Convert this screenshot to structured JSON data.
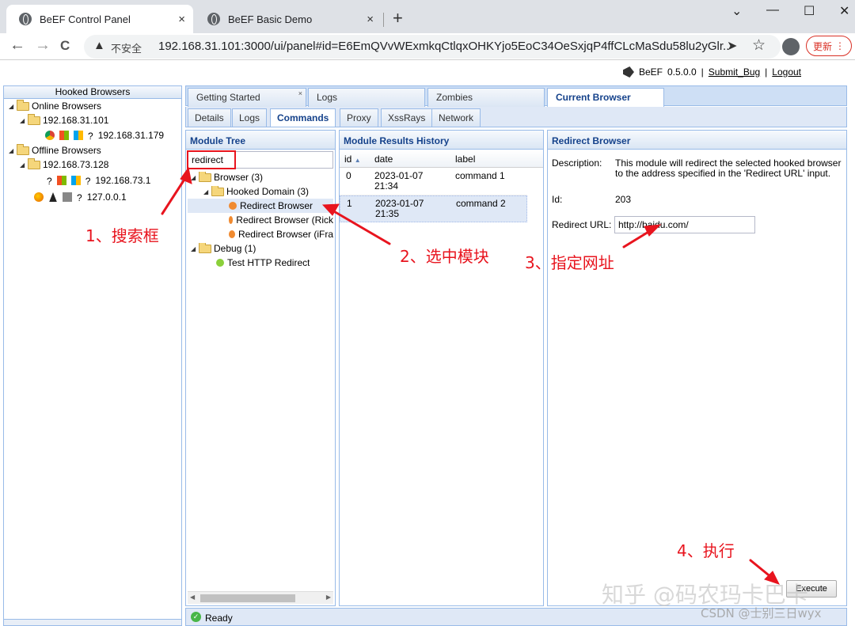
{
  "browser": {
    "tabs": [
      {
        "title": "BeEF Control Panel",
        "active": true
      },
      {
        "title": "BeEF Basic Demo",
        "active": false
      }
    ],
    "new_tab": "+",
    "close": "×",
    "window_controls": {
      "chevron": "⌄",
      "minimize": "—",
      "maximize": "☐",
      "close": "✕"
    },
    "nav": {
      "back": "←",
      "forward": "→",
      "reload": "C"
    },
    "insecure_label": "不安全",
    "url": "192.168.31.101:3000/ui/panel#id=E6EmQVvWExmkqCtlqxOHKYjo5EoC34OeSxjqP4ffCLcMaSdu58lu2yGlr...",
    "update_label": "更新",
    "icons": {
      "send": "➤",
      "star": "☆",
      "menu": "⋮",
      "warn": "▲"
    }
  },
  "header": {
    "product": "BeEF",
    "version": "0.5.0.0",
    "sep": "|",
    "submit_bug": "Submit_Bug",
    "logout": "Logout"
  },
  "hooked": {
    "title": "Hooked Browsers",
    "online": "Online Browsers",
    "online_host": "192.168.31.101",
    "online_client": "192.168.31.179",
    "offline": "Offline Browsers",
    "offline_host": "192.168.73.128",
    "offline_client": "192.168.73.1",
    "local_client": "127.0.0.1",
    "q": "?"
  },
  "main_tabs": [
    "Getting Started",
    "Logs",
    "Zombies",
    "Current Browser"
  ],
  "tab_close": "×",
  "sub_tabs": [
    "Details",
    "Logs",
    "Commands",
    "Proxy",
    "XssRays",
    "Network"
  ],
  "module_tree": {
    "title": "Module Tree",
    "search_value": "redirect",
    "browser": "Browser (3)",
    "hooked_domain": "Hooked Domain (3)",
    "items": [
      "Redirect Browser",
      "Redirect Browser (Rick",
      "Redirect Browser (iFra"
    ],
    "debug": "Debug (1)",
    "debug_item": "Test HTTP Redirect"
  },
  "results": {
    "title": "Module Results History",
    "columns": [
      "id",
      "date",
      "label"
    ],
    "sort_arrow": "▲",
    "rows": [
      {
        "id": "0",
        "date1": "2023-01-07",
        "date2": "21:34",
        "label": "command 1"
      },
      {
        "id": "1",
        "date1": "2023-01-07",
        "date2": "21:35",
        "label": "command 2"
      }
    ]
  },
  "redirect": {
    "title": "Redirect Browser",
    "desc_label": "Description:",
    "desc1": "This module will redirect the selected hooked browser",
    "desc2": "to the address specified in the 'Redirect URL' input.",
    "id_label": "Id:",
    "id_value": "203",
    "url_label": "Redirect URL:",
    "url_value": "http://baidu.com/",
    "execute": "Execute"
  },
  "status": {
    "text": "Ready",
    "icon": "✓"
  },
  "annotations": {
    "a1": "1、搜索框",
    "a2": "2、选中模块",
    "a3": "3、指定网址",
    "a4": "4、执行"
  },
  "watermark": {
    "zhihu": "知乎 @码农玛卡巴卡",
    "csdn": "CSDN @士别三日wyx"
  },
  "colors": {
    "accent": "#15428b",
    "annotation": "#e8141e",
    "border": "#99bbe8"
  }
}
